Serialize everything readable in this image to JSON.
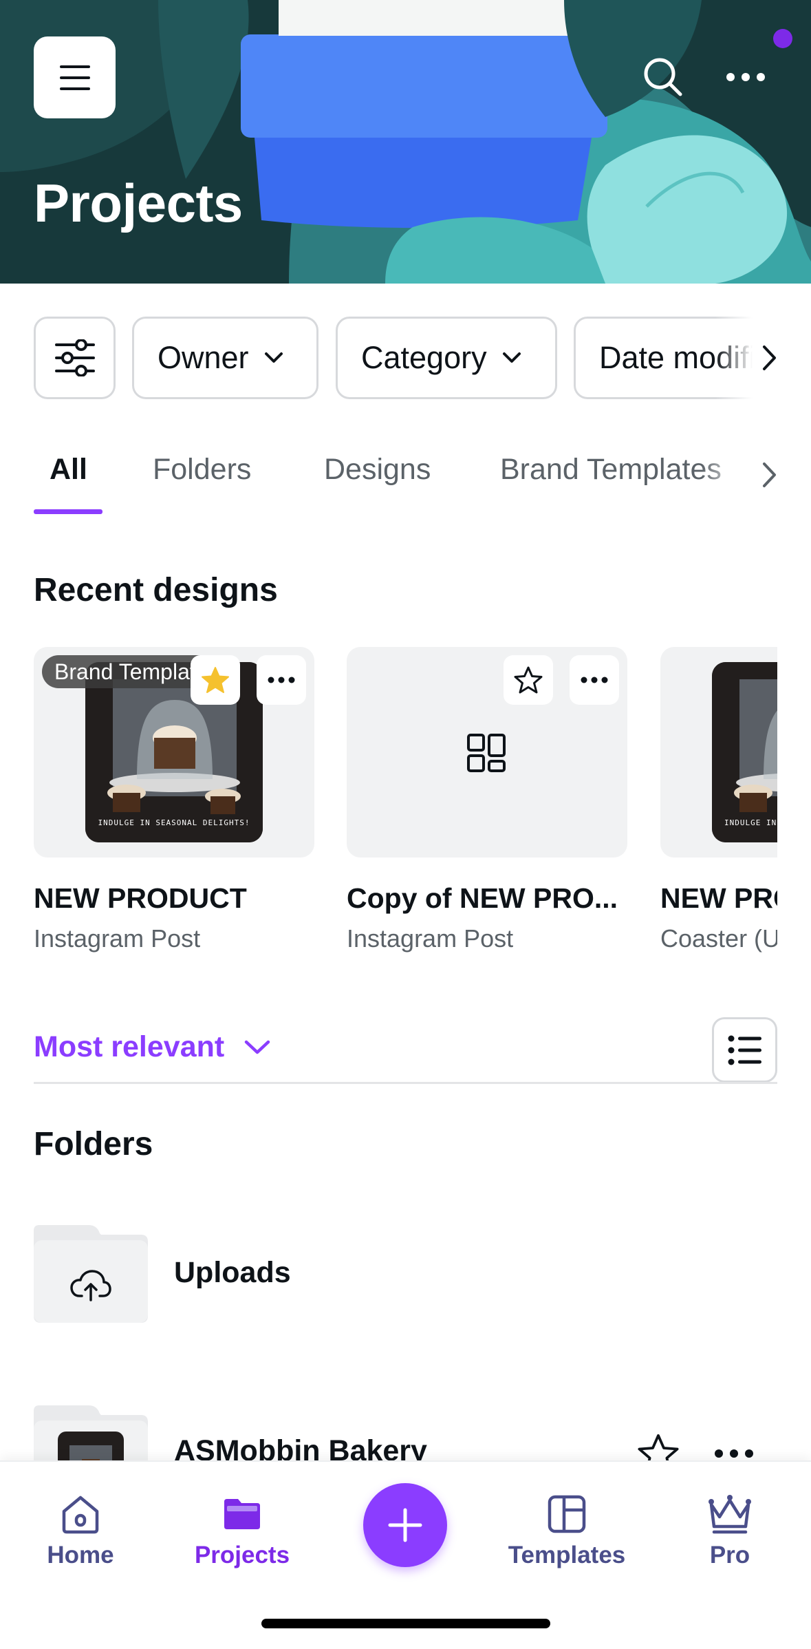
{
  "header": {
    "title": "Projects",
    "menu_icon": "hamburger-menu-icon",
    "search_icon": "search-icon",
    "more_icon": "more-horizontal-icon"
  },
  "filters": {
    "settings_icon": "sliders-icon",
    "chips": [
      {
        "label": "Owner"
      },
      {
        "label": "Category"
      },
      {
        "label": "Date modified"
      }
    ]
  },
  "tabs": [
    {
      "label": "All",
      "active": true
    },
    {
      "label": "Folders",
      "active": false
    },
    {
      "label": "Designs",
      "active": false
    },
    {
      "label": "Brand Templates",
      "active": false
    }
  ],
  "recent": {
    "title": "Recent designs",
    "items": [
      {
        "title": "NEW PRODUCT",
        "subtitle": "Instagram Post",
        "badge": "Brand Template",
        "starred": true,
        "poster_caption": "INDULGE IN SEASONAL DELIGHTS!"
      },
      {
        "title": "Copy of NEW PRO...",
        "subtitle": "Instagram Post",
        "starred": false
      },
      {
        "title": "NEW PRODUCT",
        "subtitle": "Coaster (U",
        "poster_caption": "INDULGE IN"
      }
    ]
  },
  "sort": {
    "label": "Most relevant"
  },
  "folders": {
    "title": "Folders",
    "items": [
      {
        "name": "Uploads",
        "icon": "cloud-upload-icon"
      },
      {
        "name": "ASMobbin Bakery"
      }
    ]
  },
  "bottom_nav": {
    "items": [
      {
        "label": "Home",
        "icon": "home-icon"
      },
      {
        "label": "Projects",
        "icon": "folder-icon",
        "active": true
      },
      {
        "label": "Templates",
        "icon": "templates-icon"
      },
      {
        "label": "Pro",
        "icon": "crown-icon"
      }
    ],
    "create_icon": "plus-icon"
  },
  "colors": {
    "accent": "#8b3dff",
    "nav_text": "#4a4e8a",
    "header_bg": "#163a3c",
    "star_yellow": "#f5c12e"
  }
}
